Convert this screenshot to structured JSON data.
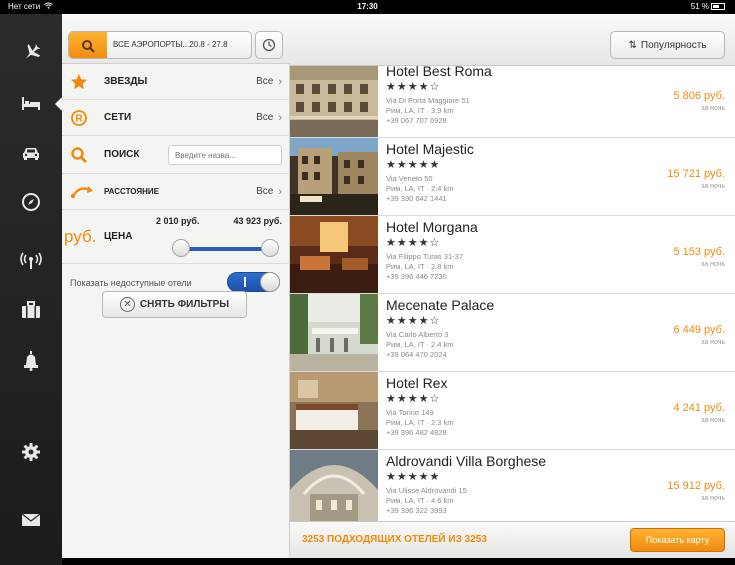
{
  "status_bar": {
    "carrier": "Нет сети",
    "time": "17:30",
    "battery": "51 %"
  },
  "rail": {
    "items": [
      {
        "icon": "airplane-icon"
      },
      {
        "icon": "bed-icon",
        "active": true
      },
      {
        "icon": "car-icon"
      },
      {
        "icon": "compass-icon"
      },
      {
        "icon": "wifi-antenna-icon"
      },
      {
        "icon": "briefcase-icon"
      },
      {
        "icon": "bell-icon"
      },
      {
        "icon": "gear-icon"
      },
      {
        "icon": "mail-icon"
      }
    ]
  },
  "filters": {
    "airports_button": "ВСЕ АЭРОПОРТЫ...20.8 - 27.8",
    "stars": {
      "label": "ЗВЕЗДЫ",
      "value": "Все"
    },
    "chains": {
      "label": "СЕТИ",
      "value": "Все"
    },
    "search": {
      "label": "ПОИСК",
      "placeholder": "Введите назва..."
    },
    "distance": {
      "label": "РАССТОЯНИЕ",
      "value": "Все"
    },
    "price": {
      "currency": "руб.",
      "label": "ЦЕНА",
      "min": "2 010 руб.",
      "max": "43 923 руб."
    },
    "unavailable": {
      "label": "Показать недоступные отели",
      "enabled": true
    },
    "reset_button": "СНЯТЬ ФИЛЬТРЫ"
  },
  "results": {
    "sort_button": "Популярность",
    "hotels": [
      {
        "name": "Hotel Best Roma",
        "stars": "★★★★☆",
        "address": "Via Di Porta Maggiore 51",
        "city": "Рим, LA, IT · 3.9 km",
        "phone": "+39 067 707 6928",
        "price": "5 806 руб.",
        "per": "за ночь",
        "thumb": "facade"
      },
      {
        "name": "Hotel Majestic",
        "stars": "★★★★★",
        "address": "Via Veneto 50",
        "city": "Рим, LA, IT · 2.4 km",
        "phone": "+39 390 642 1441",
        "price": "15 721 руб.",
        "per": "за ночь",
        "thumb": "street"
      },
      {
        "name": "Hotel Morgana",
        "stars": "★★★★☆",
        "address": "Via Filippo Turati 31-37",
        "city": "Рим, LA, IT · 2.8 km",
        "phone": "+39 396 446 7230",
        "price": "5 153 руб.",
        "per": "за ночь",
        "thumb": "lobby"
      },
      {
        "name": "Mecenate Palace",
        "stars": "★★★★☆",
        "address": "Via Carlo Alberto 3",
        "city": "Рим, LA, IT · 2.4 km",
        "phone": "+39 064 470 2024",
        "price": "6 449 руб.",
        "per": "за ночь",
        "thumb": "terrace"
      },
      {
        "name": "Hotel Rex",
        "stars": "★★★★☆",
        "address": "Via Torino 149",
        "city": "Рим, LA, IT · 2.3 km",
        "phone": "+39 396 482 4828",
        "price": "4 241 руб.",
        "per": "за ночь",
        "thumb": "room"
      },
      {
        "name": "Aldrovandi Villa Borghese",
        "stars": "★★★★★",
        "address": "Via Ulisse Aldrovandi 15",
        "city": "Рим, LA, IT · 4.6 km",
        "phone": "+39 396 322 3993",
        "price": "15 912 руб.",
        "per": "за ночь",
        "thumb": "villa"
      }
    ],
    "count_text": "3253 ПОДХОДЯЩИХ ОТЕЛЕЙ ИЗ 3253",
    "map_button": "Показать карту"
  },
  "colors": {
    "accent": "#f08a0c",
    "toggle": "#2d6fd1",
    "rail": "#222222"
  }
}
